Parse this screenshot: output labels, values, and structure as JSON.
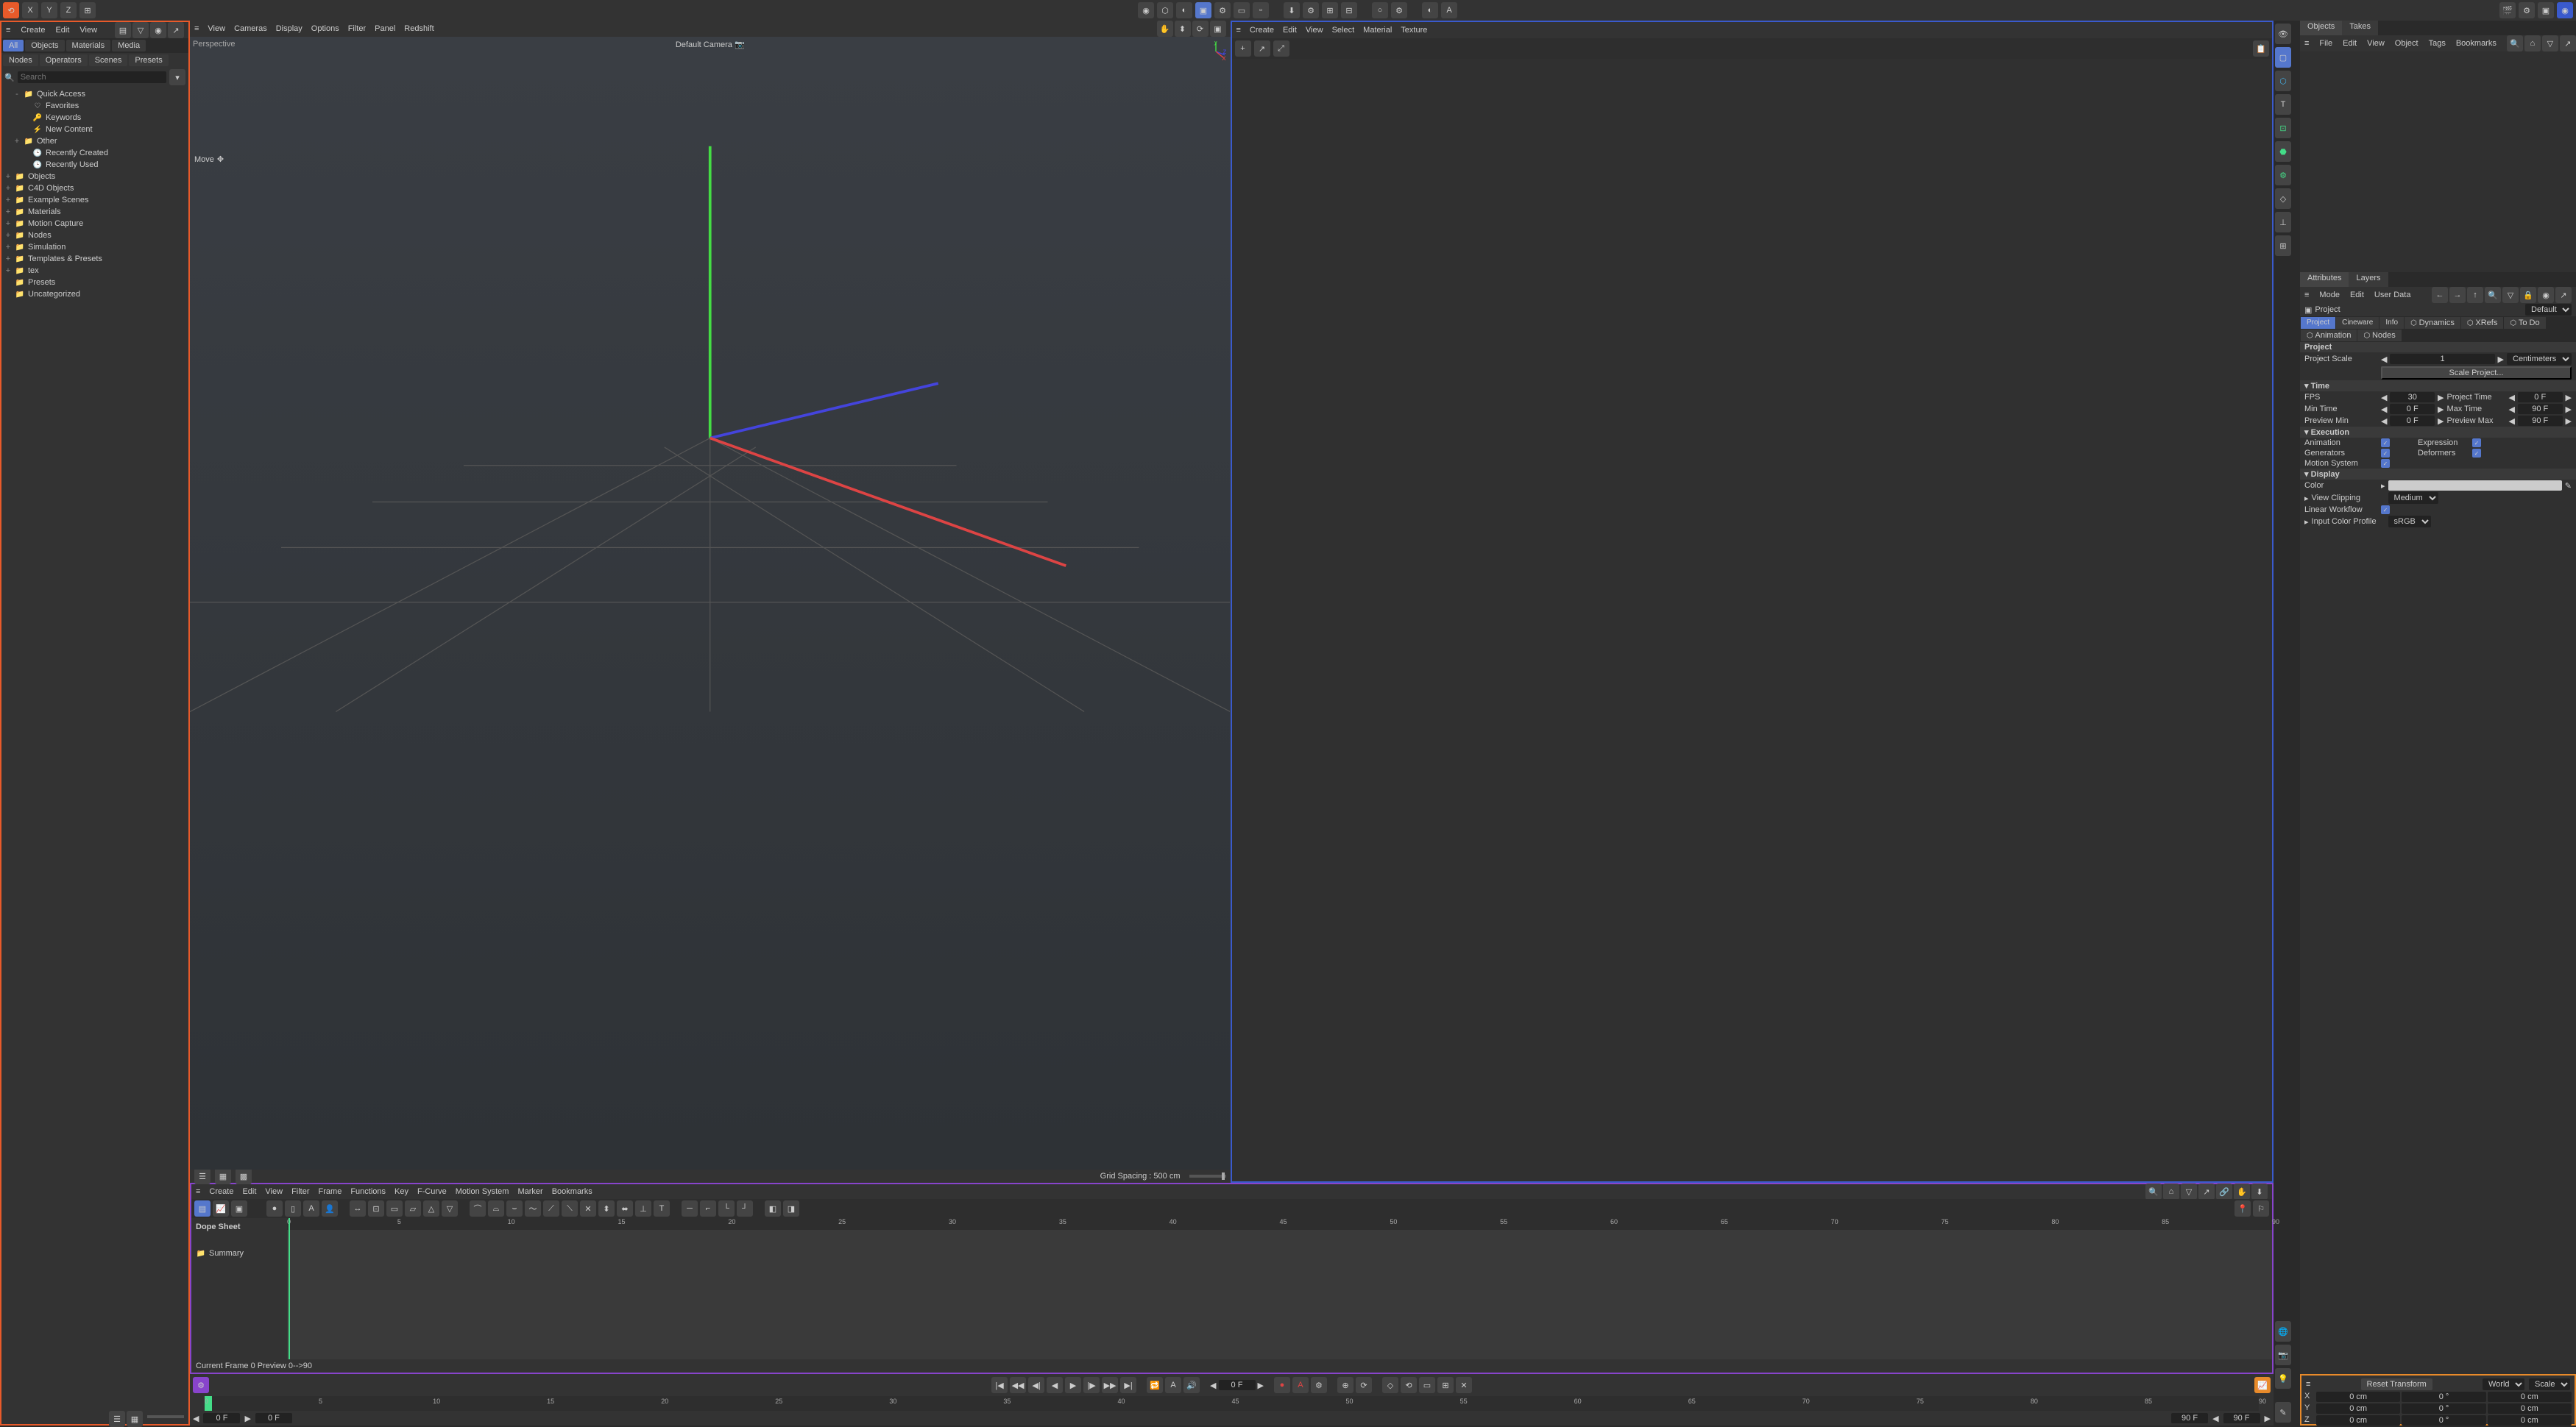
{
  "top_icons": [
    "home",
    "x-axis",
    "y-axis",
    "z-axis",
    "coords"
  ],
  "left_panel": {
    "menu": [
      "Create",
      "Edit",
      "View"
    ],
    "tabs": [
      "All",
      "Objects",
      "Materials",
      "Media"
    ],
    "sub_tabs": [
      "Nodes",
      "Operators",
      "Scenes",
      "Presets"
    ],
    "search_placeholder": "Search",
    "tree": [
      {
        "exp": "-",
        "ico": "📁",
        "label": "Quick Access",
        "indent": 1
      },
      {
        "exp": "",
        "ico": "♡",
        "label": "Favorites",
        "indent": 2
      },
      {
        "exp": "",
        "ico": "🔑",
        "label": "Keywords",
        "indent": 2
      },
      {
        "exp": "",
        "ico": "⚡",
        "label": "New Content",
        "indent": 2
      },
      {
        "exp": "+",
        "ico": "📁",
        "label": "Other",
        "indent": 1
      },
      {
        "exp": "",
        "ico": "🕒",
        "label": "Recently Created",
        "indent": 2
      },
      {
        "exp": "",
        "ico": "🕒",
        "label": "Recently Used",
        "indent": 2
      },
      {
        "exp": "+",
        "ico": "📁",
        "label": "Objects",
        "indent": 0
      },
      {
        "exp": "+",
        "ico": "📁",
        "label": "C4D Objects",
        "indent": 0
      },
      {
        "exp": "+",
        "ico": "📁",
        "label": "Example Scenes",
        "indent": 0
      },
      {
        "exp": "+",
        "ico": "📁",
        "label": "Materials",
        "indent": 0
      },
      {
        "exp": "+",
        "ico": "📁",
        "label": "Motion Capture",
        "indent": 0
      },
      {
        "exp": "+",
        "ico": "📁",
        "label": "Nodes",
        "indent": 0
      },
      {
        "exp": "+",
        "ico": "📁",
        "label": "Simulation",
        "indent": 0
      },
      {
        "exp": "+",
        "ico": "📁",
        "label": "Templates & Presets",
        "indent": 0
      },
      {
        "exp": "+",
        "ico": "📁",
        "label": "tex",
        "indent": 0
      },
      {
        "exp": "",
        "ico": "📁",
        "label": "Presets",
        "indent": 0
      },
      {
        "exp": "",
        "ico": "📁",
        "label": "Uncategorized",
        "indent": 0
      }
    ]
  },
  "viewport_left": {
    "menu": [
      "View",
      "Cameras",
      "Display",
      "Options",
      "Filter",
      "Panel",
      "Redshift"
    ],
    "label_tl": "Perspective",
    "label_tc": "Default Camera",
    "move_label": "Move",
    "grid_status": "Grid Spacing : 500 cm"
  },
  "viewport_right": {
    "menu": [
      "Create",
      "Edit",
      "View",
      "Select",
      "Material",
      "Texture"
    ]
  },
  "right_panel": {
    "obj_tabs": [
      "Objects",
      "Takes"
    ],
    "obj_menu": [
      "File",
      "Edit",
      "View",
      "Object",
      "Tags",
      "Bookmarks"
    ],
    "attr_tabs": [
      "Attributes",
      "Layers"
    ],
    "attr_menu": [
      "Mode",
      "Edit",
      "User Data"
    ],
    "project_label": "Project",
    "default_label": "Default",
    "proj_tabs": [
      "Project",
      "Cineware",
      "Info",
      "Dynamics",
      "XRefs"
    ],
    "proj_tabs2": [
      "To Do",
      "Animation",
      "Nodes"
    ],
    "section_project": "Project",
    "project_scale_label": "Project Scale",
    "project_scale_val": "1",
    "project_scale_unit": "Centimeters",
    "scale_project_btn": "Scale Project...",
    "section_time": "Time",
    "fps_label": "FPS",
    "fps_val": "30",
    "project_time_label": "Project Time",
    "project_time_val": "0 F",
    "min_time_label": "Min Time",
    "min_time_val": "0 F",
    "max_time_label": "Max Time",
    "max_time_val": "90 F",
    "preview_min_label": "Preview Min",
    "preview_min_val": "0 F",
    "preview_max_label": "Preview Max",
    "preview_max_val": "90 F",
    "section_exec": "Execution",
    "animation_label": "Animation",
    "expression_label": "Expression",
    "generators_label": "Generators",
    "deformers_label": "Deformers",
    "motion_system_label": "Motion System",
    "section_display": "Display",
    "color_label": "Color",
    "view_clipping_label": "View Clipping",
    "view_clipping_val": "Medium",
    "linear_workflow_label": "Linear Workflow",
    "input_color_label": "Input Color Profile",
    "input_color_val": "sRGB"
  },
  "dope": {
    "menu": [
      "Create",
      "Edit",
      "View",
      "Filter",
      "Frame",
      "Functions",
      "Key",
      "F-Curve",
      "Motion System",
      "Marker",
      "Bookmarks"
    ],
    "title": "Dope Sheet",
    "summary": "Summary",
    "ticks": [
      0,
      5,
      10,
      15,
      20,
      25,
      30,
      35,
      40,
      45,
      50,
      55,
      60,
      65,
      70,
      75,
      80,
      85,
      90
    ],
    "status": "Current Frame  0   Preview   0-->90"
  },
  "transport": {
    "frame_field": "0 F",
    "ruler_ticks": [
      0,
      5,
      10,
      15,
      20,
      25,
      30,
      35,
      40,
      45,
      50,
      55,
      60,
      65,
      70,
      75,
      80,
      85,
      90
    ],
    "start_frame": "0 F",
    "preview_start": "0 F",
    "end_frame": "90 F",
    "preview_end": "90 F"
  },
  "coord": {
    "reset_label": "Reset Transform",
    "space": "World",
    "mode": "Scale",
    "rows": [
      {
        "axis": "X",
        "p": "0 cm",
        "r": "0 °",
        "s": "0 cm"
      },
      {
        "axis": "Y",
        "p": "0 cm",
        "r": "0 °",
        "s": "0 cm"
      },
      {
        "axis": "Z",
        "p": "0 cm",
        "r": "0 °",
        "s": "0 cm"
      }
    ]
  }
}
